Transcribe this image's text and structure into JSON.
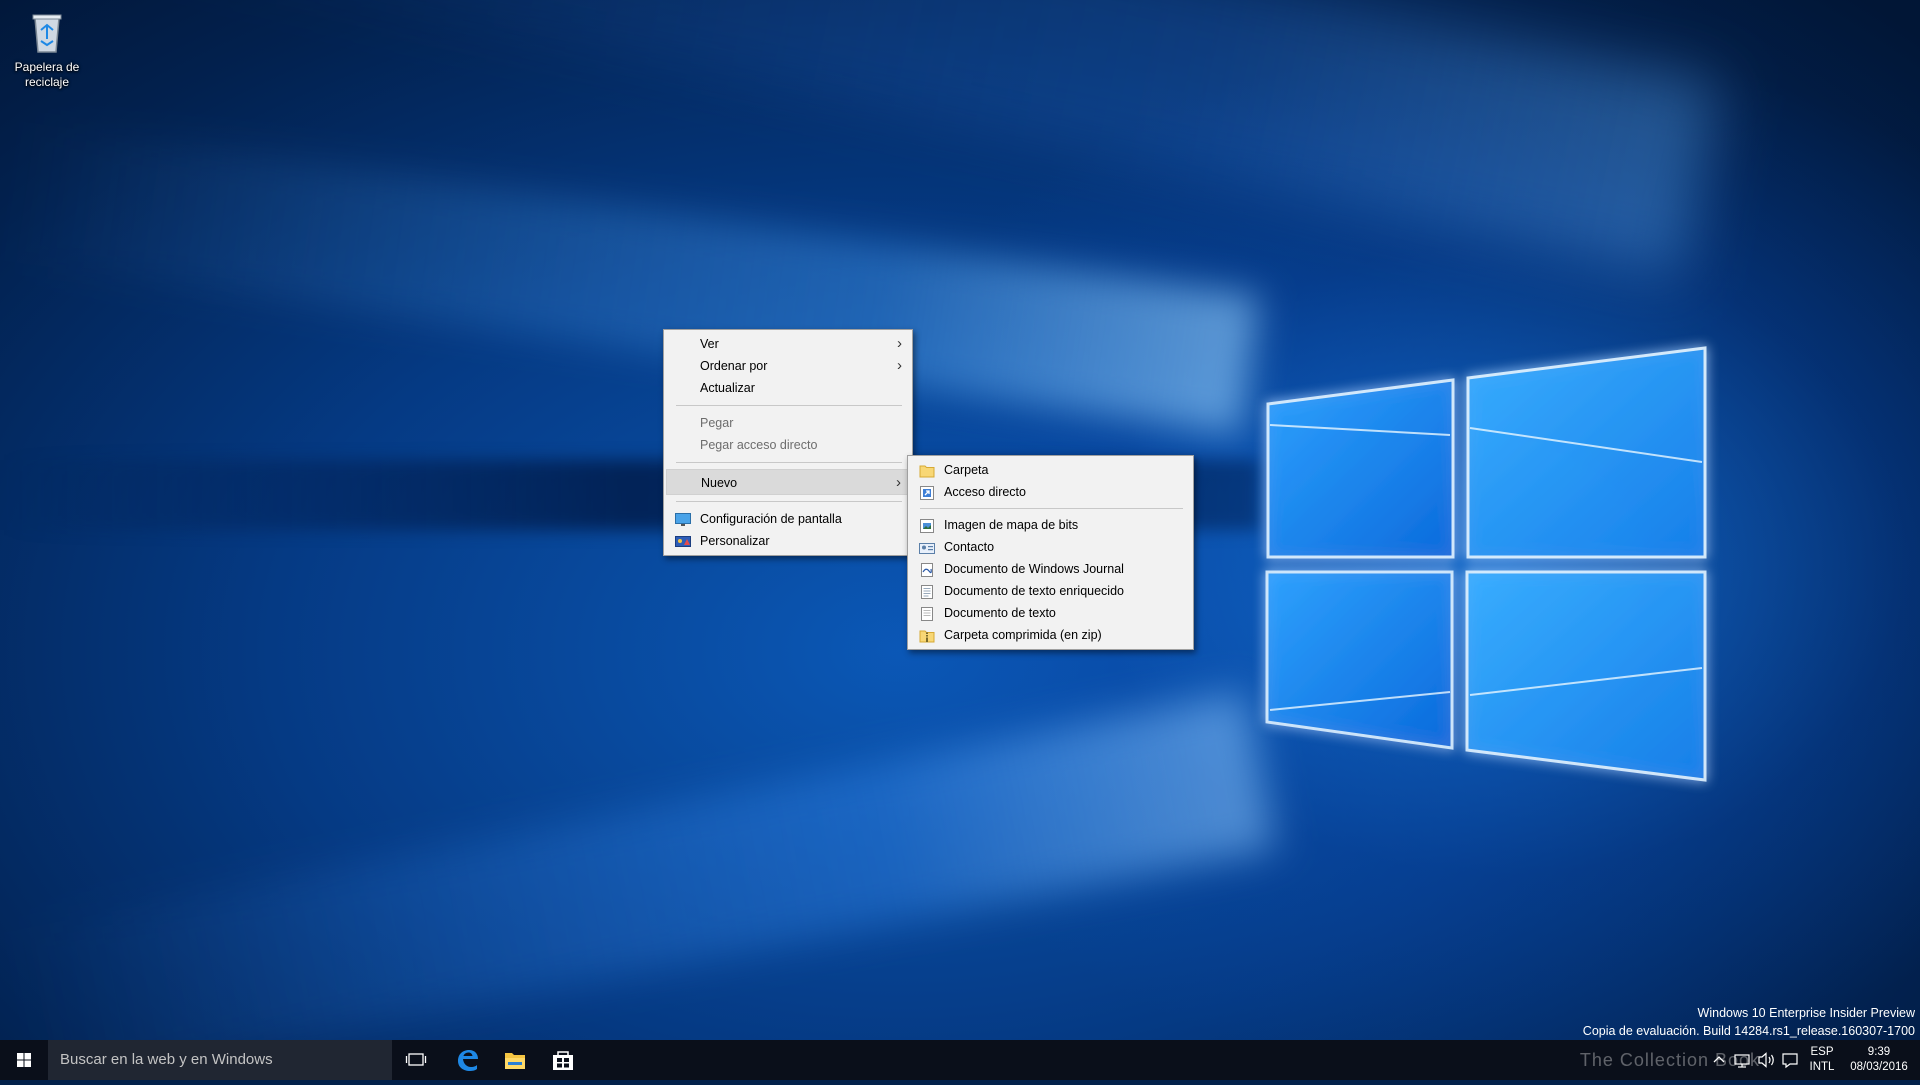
{
  "desktop": {
    "icons": [
      {
        "label": "Papelera de reciclaje",
        "icon": "recycle-bin-icon"
      }
    ]
  },
  "context_menu": {
    "items": [
      {
        "label": "Ver",
        "has_submenu": true,
        "enabled": true
      },
      {
        "label": "Ordenar por",
        "has_submenu": true,
        "enabled": true
      },
      {
        "label": "Actualizar",
        "enabled": true
      },
      {
        "label": "Pegar",
        "enabled": false
      },
      {
        "label": "Pegar acceso directo",
        "enabled": false
      },
      {
        "label": "Nuevo",
        "has_submenu": true,
        "enabled": true,
        "highlighted": true
      },
      {
        "label": "Configuración de pantalla",
        "icon": "display-settings-icon",
        "enabled": true
      },
      {
        "label": "Personalizar",
        "icon": "personalize-icon",
        "enabled": true
      }
    ]
  },
  "submenu_nuevo": {
    "items": [
      {
        "label": "Carpeta",
        "icon": "folder-icon"
      },
      {
        "label": "Acceso directo",
        "icon": "shortcut-icon"
      },
      {
        "label": "Imagen de mapa de bits",
        "icon": "bitmap-image-icon"
      },
      {
        "label": "Contacto",
        "icon": "contact-card-icon"
      },
      {
        "label": "Documento de Windows Journal",
        "icon": "journal-document-icon"
      },
      {
        "label": "Documento de texto enriquecido",
        "icon": "rich-text-document-icon"
      },
      {
        "label": "Documento de texto",
        "icon": "text-document-icon"
      },
      {
        "label": "Carpeta comprimida (en zip)",
        "icon": "zip-folder-icon"
      }
    ]
  },
  "watermark": {
    "line1": "Windows 10 Enterprise Insider Preview",
    "line2": "Copia de evaluación. Build 14284.rs1_release.160307-1700"
  },
  "taskbar": {
    "search_placeholder": "Buscar en la web y en Windows",
    "pinned": [
      "task-view-icon",
      "edge-icon",
      "file-explorer-icon",
      "store-icon"
    ],
    "tray": {
      "language_top": "ESP",
      "language_bottom": "INTL",
      "time": "9:39",
      "date": "08/03/2016"
    },
    "overlay_text": "The Collection Book"
  },
  "colors": {
    "menu_bg": "#f2f2f2",
    "menu_highlight": "#dadada",
    "taskbar_bg": "#0a0f1a",
    "search_bg": "#202632",
    "accent": "#1e88ff"
  }
}
